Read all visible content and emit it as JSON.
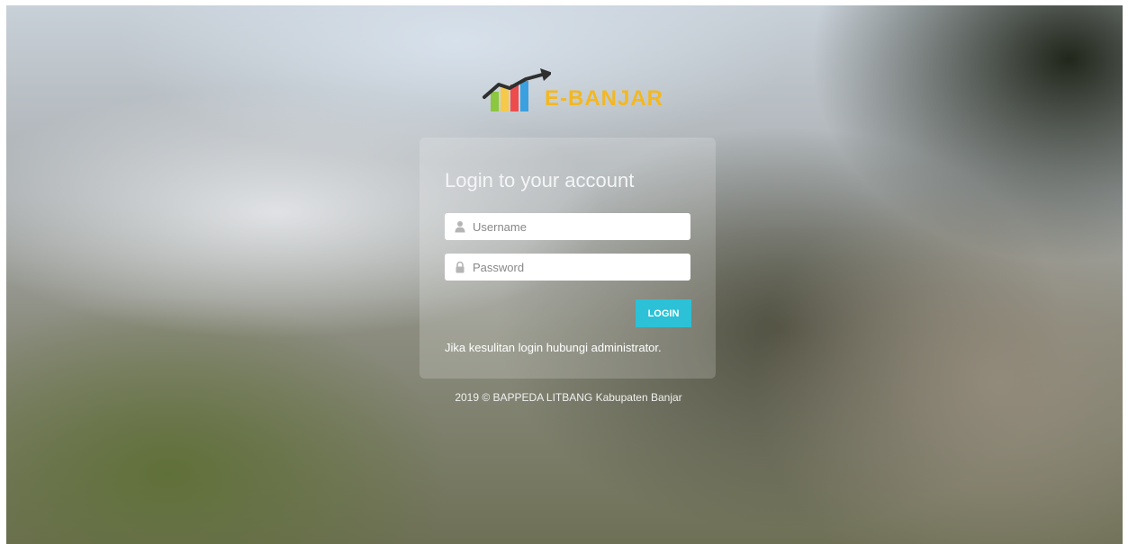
{
  "brand": {
    "name": "E-BANJAR",
    "logo_icon": "bar-chart-trend-arrow-icon",
    "colors": {
      "brand_text": "#f3b820",
      "bar_green": "#8dc63f",
      "bar_yellow": "#f7c948",
      "bar_red": "#ee4c4c",
      "bar_blue": "#3aa0e0",
      "arrow": "#2f2f2f"
    }
  },
  "login": {
    "title": "Login to your account",
    "username": {
      "placeholder": "Username",
      "value": "",
      "icon": "user-icon"
    },
    "password": {
      "placeholder": "Password",
      "value": "",
      "icon": "lock-icon"
    },
    "submit_label": "LOGIN",
    "button_color": "#2cc1d6",
    "help_text": "Jika kesulitan login hubungi administrator."
  },
  "footer": {
    "text": "2019 © BAPPEDA LITBANG Kabupaten Banjar"
  }
}
